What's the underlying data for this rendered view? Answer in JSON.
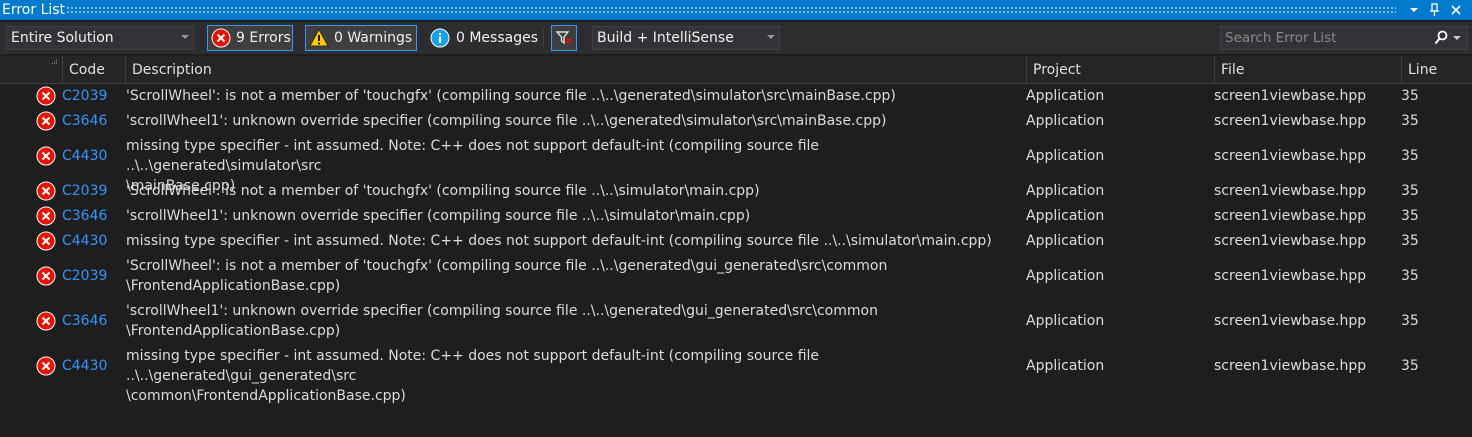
{
  "window": {
    "title": "Error List"
  },
  "toolbar": {
    "scope": "Entire Solution",
    "errors_label": "9 Errors",
    "warnings_label": "0 Warnings",
    "messages_label": "0 Messages",
    "build_filter": "Build + IntelliSense",
    "search_placeholder": "Search Error List"
  },
  "columns": {
    "code": "Code",
    "description": "Description",
    "project": "Project",
    "file": "File",
    "line": "Line"
  },
  "rows": [
    {
      "code": "C2039",
      "description": "'ScrollWheel': is not a member of 'touchgfx' (compiling source file ..\\..\\generated\\simulator\\src\\mainBase.cpp)",
      "project": "Application",
      "file": "screen1viewbase.hpp",
      "line": "35"
    },
    {
      "code": "C3646",
      "description": "'scrollWheel1': unknown override specifier (compiling source file ..\\..\\generated\\simulator\\src\\mainBase.cpp)",
      "project": "Application",
      "file": "screen1viewbase.hpp",
      "line": "35"
    },
    {
      "code": "C4430",
      "description": "missing type specifier - int assumed. Note: C++ does not support default-int (compiling source file ..\\..\\generated\\simulator\\src\n\\mainBase.cpp)",
      "project": "Application",
      "file": "screen1viewbase.hpp",
      "line": "35"
    },
    {
      "code": "C2039",
      "description": "'ScrollWheel': is not a member of 'touchgfx' (compiling source file ..\\..\\simulator\\main.cpp)",
      "project": "Application",
      "file": "screen1viewbase.hpp",
      "line": "35"
    },
    {
      "code": "C3646",
      "description": "'scrollWheel1': unknown override specifier (compiling source file ..\\..\\simulator\\main.cpp)",
      "project": "Application",
      "file": "screen1viewbase.hpp",
      "line": "35"
    },
    {
      "code": "C4430",
      "description": "missing type specifier - int assumed. Note: C++ does not support default-int (compiling source file ..\\..\\simulator\\main.cpp)",
      "project": "Application",
      "file": "screen1viewbase.hpp",
      "line": "35"
    },
    {
      "code": "C2039",
      "description": "'ScrollWheel': is not a member of 'touchgfx' (compiling source file ..\\..\\generated\\gui_generated\\src\\common\n\\FrontendApplicationBase.cpp)",
      "project": "Application",
      "file": "screen1viewbase.hpp",
      "line": "35"
    },
    {
      "code": "C3646",
      "description": "'scrollWheel1': unknown override specifier (compiling source file ..\\..\\generated\\gui_generated\\src\\common\n\\FrontendApplicationBase.cpp)",
      "project": "Application",
      "file": "screen1viewbase.hpp",
      "line": "35"
    },
    {
      "code": "C4430",
      "description": "missing type specifier - int assumed. Note: C++ does not support default-int (compiling source file ..\\..\\generated\\gui_generated\\src\n\\common\\FrontendApplicationBase.cpp)",
      "project": "Application",
      "file": "screen1viewbase.hpp",
      "line": "35"
    }
  ],
  "colors": {
    "title_bar": "#007acc",
    "background": "#1e1e1e",
    "error_icon": "#e51400",
    "warning_icon": "#ffcc00",
    "info_icon": "#1ba1e2",
    "code_link": "#3794ff"
  },
  "icons": [
    "dropdown-icon",
    "pin-icon",
    "close-icon",
    "error-icon",
    "warning-icon",
    "info-icon",
    "filter-icon",
    "search-icon"
  ]
}
